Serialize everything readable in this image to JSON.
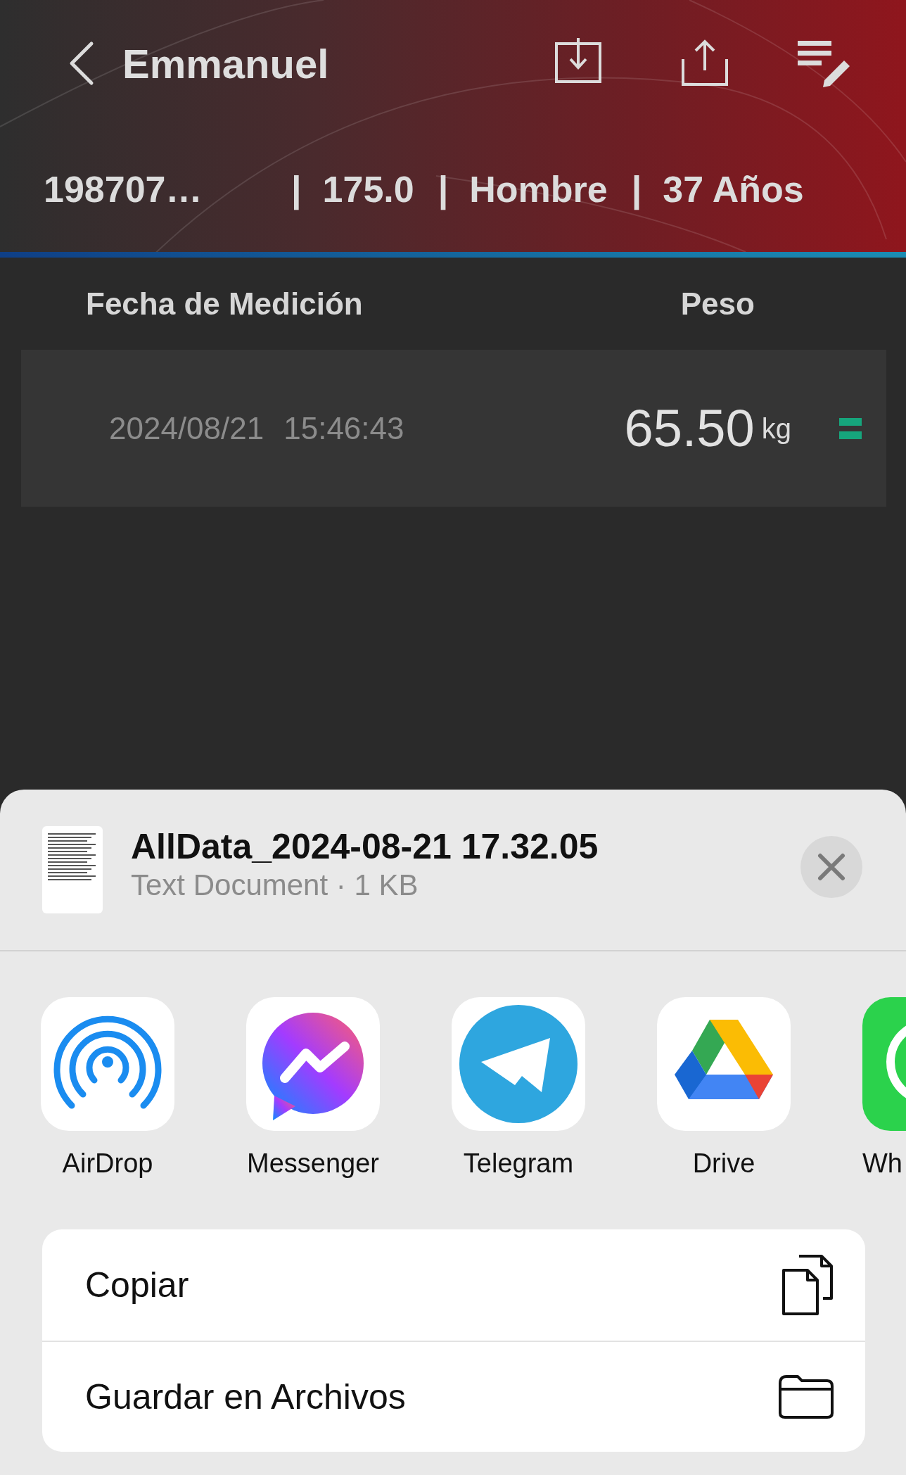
{
  "header": {
    "title": "Emmanuel",
    "info": [
      {
        "kind": "value",
        "text": "198707…"
      },
      {
        "kind": "separator",
        "text": "|"
      },
      {
        "kind": "value",
        "text": "175.0"
      },
      {
        "kind": "separator",
        "text": "|"
      },
      {
        "kind": "value",
        "text": "Hombre"
      },
      {
        "kind": "separator",
        "text": "|"
      },
      {
        "kind": "value",
        "text": "37 Años"
      }
    ]
  },
  "table": {
    "columns": [
      "Fecha de Medición",
      "Peso"
    ],
    "rows": [
      {
        "date": "2024/08/21",
        "time": "15:46:43",
        "weight": "65.50",
        "unit": "kg"
      }
    ]
  },
  "share_sheet": {
    "file": {
      "name": "AllData_2024-08-21 17.32.05",
      "details": "Text Document · 1 KB"
    },
    "apps": [
      {
        "kind": "airdrop",
        "label": "AirDrop"
      },
      {
        "kind": "messenger",
        "label": "Messenger"
      },
      {
        "kind": "telegram",
        "label": "Telegram"
      },
      {
        "kind": "drive",
        "label": "Drive"
      },
      {
        "kind": "whatsapp",
        "label": "Wh"
      }
    ],
    "actions": [
      {
        "kind": "copy",
        "label": "Copiar"
      },
      {
        "kind": "save",
        "label": "Guardar en Archivos"
      }
    ]
  }
}
